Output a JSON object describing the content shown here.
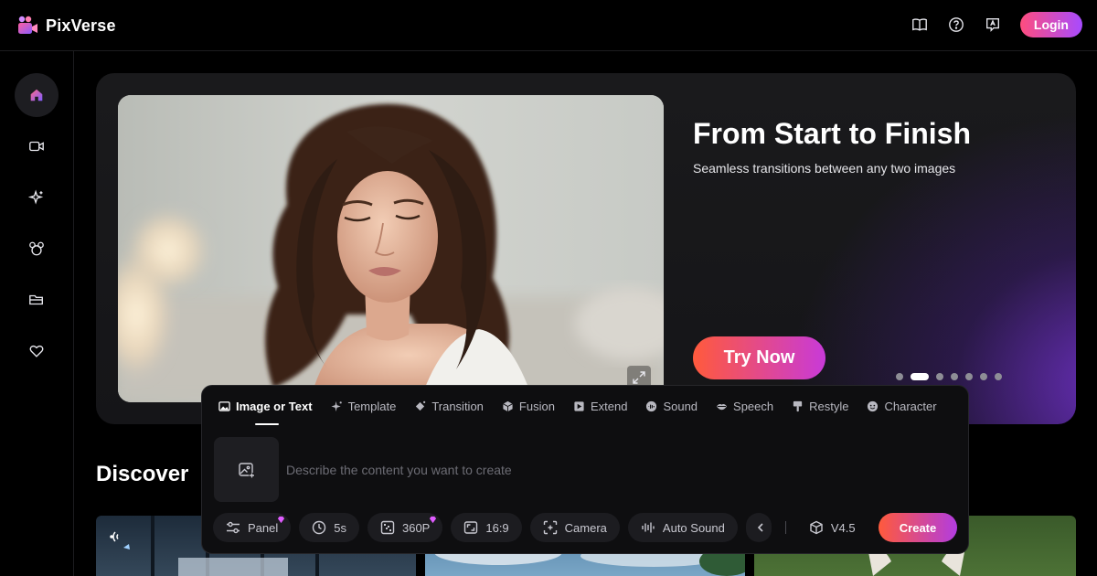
{
  "app": {
    "name": "PixVerse"
  },
  "header": {
    "login_label": "Login"
  },
  "hero": {
    "title": "From Start to Finish",
    "subtitle": "Seamless transitions between any two images",
    "cta_label": "Try Now",
    "slide_count": 7,
    "active_slide": 2
  },
  "discover": {
    "title": "Discover"
  },
  "create": {
    "tabs": [
      {
        "label": "Image or Text",
        "icon": "image-icon",
        "active": true
      },
      {
        "label": "Template",
        "icon": "sparkle-icon"
      },
      {
        "label": "Transition",
        "icon": "transition-icon"
      },
      {
        "label": "Fusion",
        "icon": "cube-icon"
      },
      {
        "label": "Extend",
        "icon": "extend-icon"
      },
      {
        "label": "Sound",
        "icon": "sound-icon"
      },
      {
        "label": "Speech",
        "icon": "lips-icon"
      },
      {
        "label": "Restyle",
        "icon": "brush-icon"
      },
      {
        "label": "Character",
        "icon": "face-icon"
      }
    ],
    "prompt_placeholder": "Describe the content you want to create",
    "toolbar": {
      "panel": "Panel",
      "duration": "5s",
      "resolution": "360P",
      "aspect": "16:9",
      "camera": "Camera",
      "auto_sound": "Auto Sound",
      "model": "V4.5"
    },
    "create_label": "Create"
  },
  "colors": {
    "accent_gradient_start": "#ff5a3c",
    "accent_gradient_end": "#b23ce0",
    "login_gradient_start": "#ff4d7e",
    "login_gradient_end": "#a74bff",
    "background": "#000000"
  }
}
